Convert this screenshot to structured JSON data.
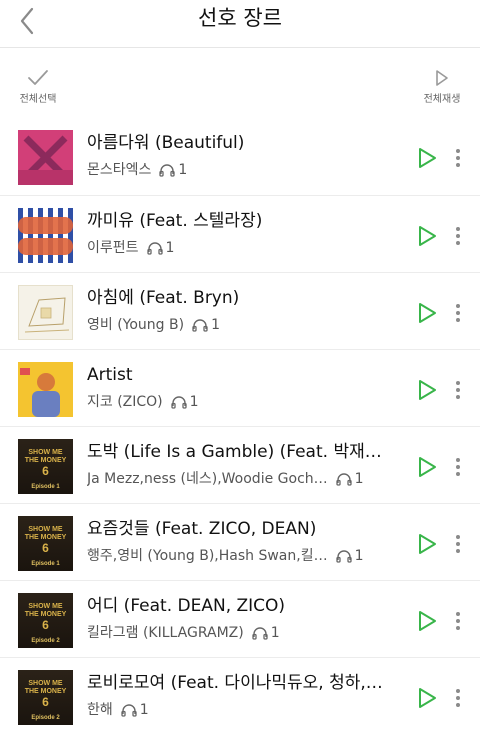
{
  "header": {
    "title": "선호 장르"
  },
  "toolbar": {
    "select_all_label": "전체선택",
    "play_all_label": "전체재생"
  },
  "colors": {
    "accent_green": "#39b54a",
    "divider": "#e6e6e6"
  },
  "songs": [
    {
      "title": "아름다워 (Beautiful)",
      "artist": "몬스타엑스",
      "plays": "1"
    },
    {
      "title": "까미유 (Feat. 스텔라장)",
      "artist": "이루펀트",
      "plays": "1"
    },
    {
      "title": "아침에 (Feat. Bryn)",
      "artist": "영비 (Young B)",
      "plays": "1"
    },
    {
      "title": "Artist",
      "artist": "지코 (ZICO)",
      "plays": "1"
    },
    {
      "title": "도박 (Life Is a Gamble) (Feat. 박재…",
      "artist": "Ja Mezz,ness (네스),Woodie Goch…",
      "plays": "1"
    },
    {
      "title": "요즘것들 (Feat. ZICO, DEAN)",
      "artist": "행주,영비 (Young B),Hash Swan,킬…",
      "plays": "1"
    },
    {
      "title": "어디 (Feat. DEAN, ZICO)",
      "artist": "킬라그램 (KILLAGRAMZ)",
      "plays": "1"
    },
    {
      "title": "로비로모여 (Feat. 다이나믹듀오, 청하,…",
      "artist": "한해",
      "plays": "1"
    }
  ],
  "thumbnail_labels": {
    "smtm": "SHOW ME THE MONEY 6",
    "ep1": "Episode 1",
    "ep2": "Episode 2"
  }
}
